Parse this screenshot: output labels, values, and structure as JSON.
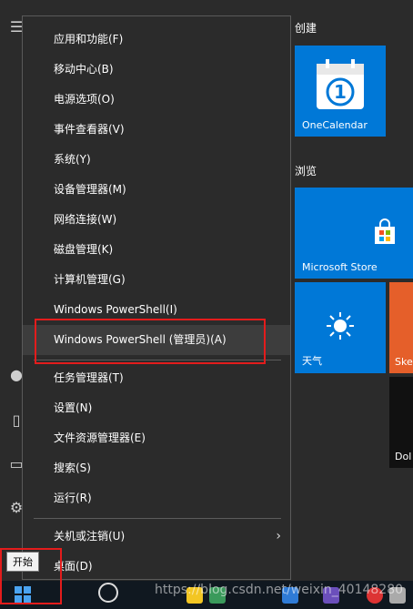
{
  "menu": {
    "items": [
      {
        "label": "应用和功能(F)"
      },
      {
        "label": "移动中心(B)"
      },
      {
        "label": "电源选项(O)"
      },
      {
        "label": "事件查看器(V)"
      },
      {
        "label": "系统(Y)"
      },
      {
        "label": "设备管理器(M)"
      },
      {
        "label": "网络连接(W)"
      },
      {
        "label": "磁盘管理(K)"
      },
      {
        "label": "计算机管理(G)"
      },
      {
        "label": "Windows PowerShell(I)"
      },
      {
        "label": "Windows PowerShell (管理员)(A)"
      },
      {
        "label": "任务管理器(T)"
      },
      {
        "label": "设置(N)"
      },
      {
        "label": "文件资源管理器(E)"
      },
      {
        "label": "搜索(S)"
      },
      {
        "label": "运行(R)"
      },
      {
        "label": "关机或注销(U)"
      },
      {
        "label": "桌面(D)"
      }
    ]
  },
  "tiles": {
    "group1": "创建",
    "group2": "浏览",
    "onecalendar": "OneCalendar",
    "store": "Microsoft Store",
    "weather": "天气",
    "ske": "Ske",
    "dol": "Dol"
  },
  "taskbar": {
    "tooltip": "开始",
    "watermark": "https://blog.csdn.net/weixin_40148280"
  },
  "colors": {
    "accent": "#0078d7",
    "highlight": "#e31c1c",
    "menu_bg": "#2b2b2b"
  }
}
